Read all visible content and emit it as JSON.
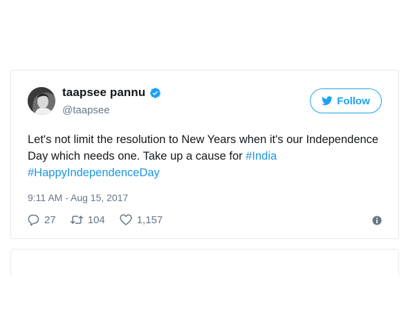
{
  "author": {
    "name": "taapsee pannu",
    "handle": "@taapsee"
  },
  "follow_label": "Follow",
  "tweet": {
    "text_part1": "Let's not limit the resolution to New Years when it's our Independence Day which needs one. Take up a cause for ",
    "hashtag_india": "#India",
    "hashtag_happy": "#HappyIndependenceDay"
  },
  "timestamp": "9:11 AM - Aug 15, 2017",
  "counts": {
    "replies": "27",
    "retweets": "104",
    "likes": "1,157"
  },
  "colors": {
    "accent": "#1da1f2",
    "link": "#1b95e0",
    "muted": "#657786",
    "border": "#e1e8ed"
  },
  "icons": [
    "verified-badge-icon",
    "twitter-bird-icon",
    "reply-icon",
    "retweet-icon",
    "like-icon",
    "info-icon"
  ]
}
